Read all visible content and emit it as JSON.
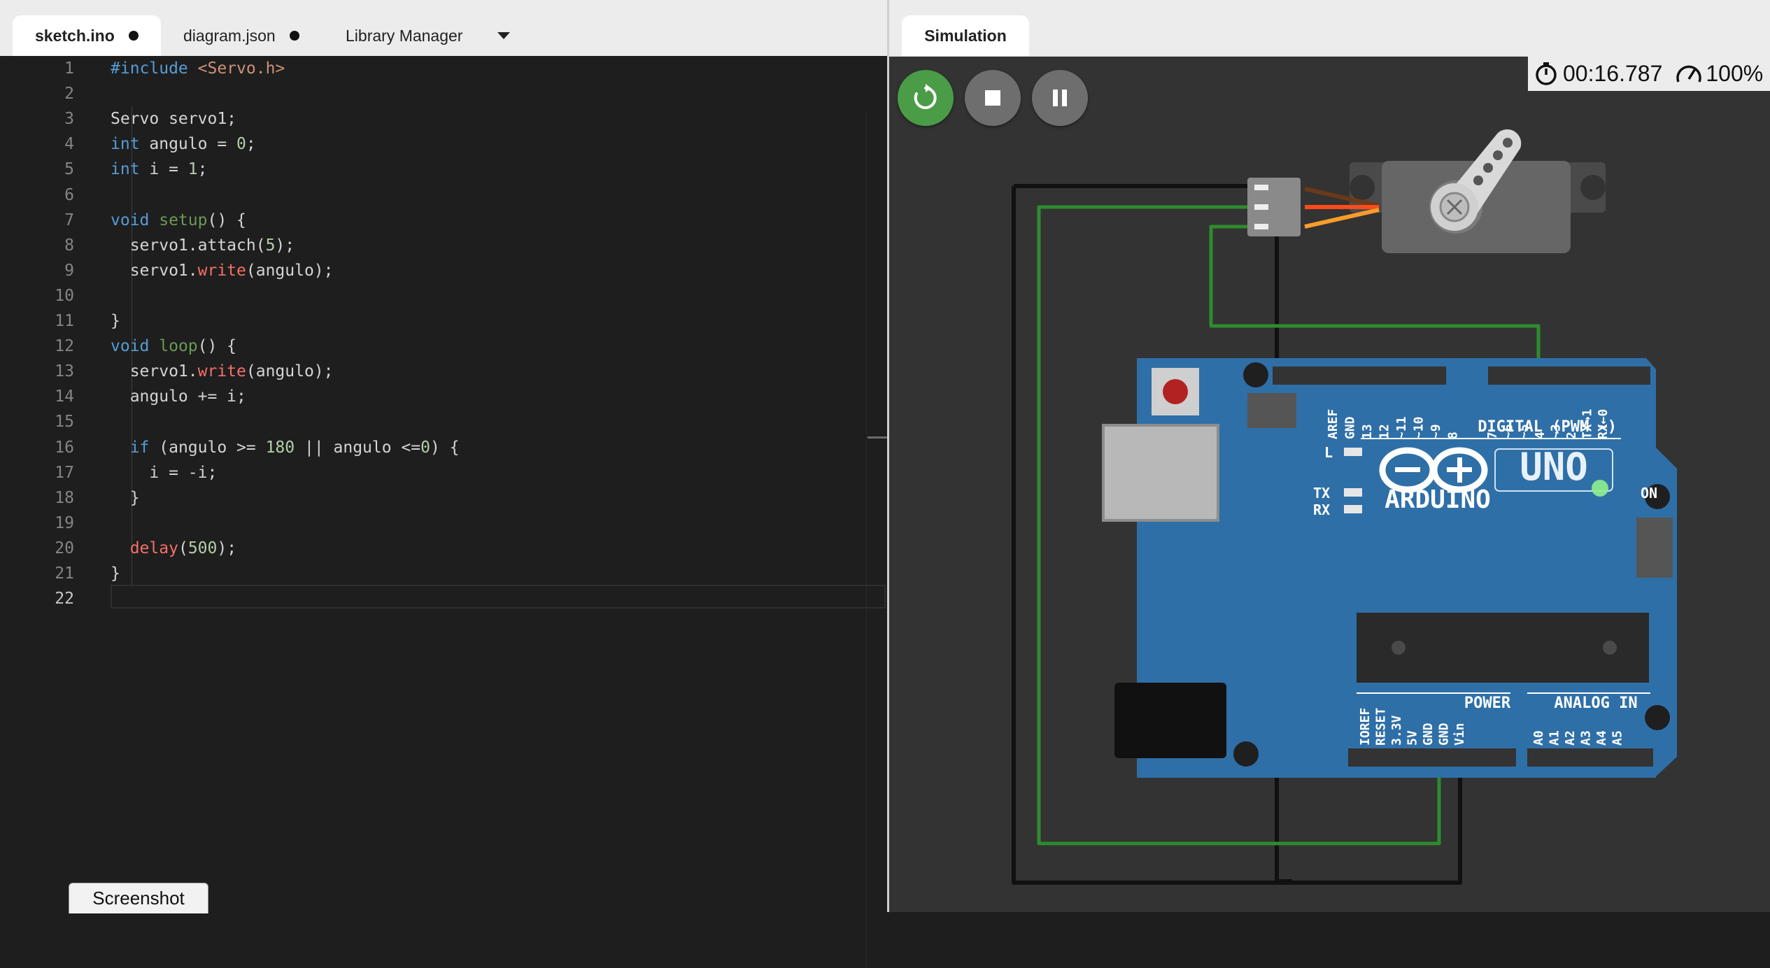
{
  "editor": {
    "tabs": [
      {
        "label": "sketch.ino",
        "modified": true,
        "active": true
      },
      {
        "label": "diagram.json",
        "modified": true,
        "active": false
      },
      {
        "label": "Library Manager",
        "modified": false,
        "active": false
      }
    ],
    "current_line": 22,
    "lines": [
      "#include <Servo.h>",
      "",
      "Servo servo1;",
      "int angulo = 0;",
      "int i = 1;",
      "",
      "void setup() {",
      "  servo1.attach(5);",
      "  servo1.write(angulo);",
      "",
      "}",
      "void loop() {",
      "  servo1.write(angulo);",
      "  angulo += i;",
      "",
      "  if (angulo >= 180 || angulo <=0) {",
      "    i = -i;",
      "  }",
      "",
      "  delay(500);",
      "}",
      ""
    ]
  },
  "screenshot_button": "Screenshot",
  "simulation": {
    "tab_label": "Simulation",
    "timer": "00:16.787",
    "speed": "100%",
    "controls": {
      "restart": "restart-icon",
      "stop": "stop-icon",
      "pause": "pause-icon"
    },
    "colors": {
      "restart_bg": "#4a9d46",
      "button_bg": "#6e6e6e",
      "board": "#2f6fa7",
      "wire_green": "#2e8b2e",
      "wire_black": "#111111"
    },
    "board": {
      "brand": "ARDUINO",
      "model": "UNO",
      "digital_header": "DIGITAL (PWM ~)",
      "power_header": "POWER",
      "analog_header": "ANALOG IN",
      "on_label": "ON",
      "l_label": "L",
      "tx_label": "TX",
      "rx_label": "RX",
      "digital_pins": [
        "AREF",
        "GND",
        "13",
        "12",
        "~11",
        "~10",
        "~9",
        "8",
        "7",
        "~6",
        "~5",
        "4",
        "~3",
        "2",
        "TX→1",
        "RX←0"
      ],
      "power_pins": [
        "IOREF",
        "RESET",
        "3.3V",
        "5V",
        "GND",
        "GND",
        "Vin"
      ],
      "analog_pins": [
        "A0",
        "A1",
        "A2",
        "A3",
        "A4",
        "A5"
      ]
    }
  }
}
